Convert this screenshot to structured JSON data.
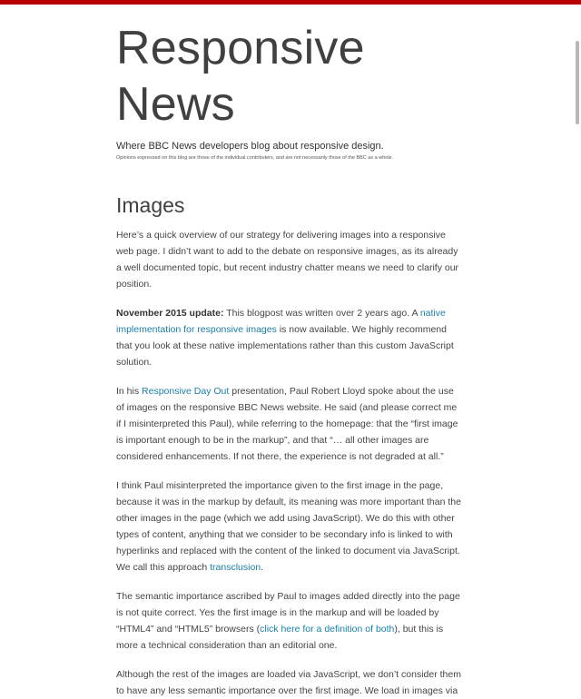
{
  "colors": {
    "top_bar": "#b80000",
    "link": "#1a7fa8"
  },
  "header": {
    "site_title": "Responsive News",
    "tagline": "Where BBC News developers blog about responsive design.",
    "disclaimer": "Opinions expressed on this blog are those of the individual contributers, and are not necessarily those of the BBC as a whole."
  },
  "post": {
    "title": "Images",
    "paragraphs": [
      [
        {
          "text": "Here’s a quick overview of our strategy for delivering images into a responsive web page. I didn’t want to add to the debate on responsive images, as its already a well documented topic, but recent industry chatter means we need to clarify our position."
        }
      ],
      [
        {
          "text": "November 2015 update:",
          "bold": true
        },
        {
          "text": " This blogpost was written over 2 years ago. A "
        },
        {
          "text": "native implementation for responsive images",
          "link": true
        },
        {
          "text": " is now available. We highly recommend that you look at these native implementations rather than this custom JavaScript solution."
        }
      ],
      [
        {
          "text": "In his "
        },
        {
          "text": "Responsive Day Out",
          "link": true
        },
        {
          "text": " presentation, Paul Robert Lloyd spoke about the use of images on the responsive BBC News website. He said (and please correct me if I misinterpreted this Paul), while referring to the homepage: that the “first image is important enough to be in the markup”, and that “… all other images are considered enhancements. If not there, the experience is not degraded at all.”"
        }
      ],
      [
        {
          "text": "I think Paul misinterpreted the importance given to the first image in the page, because it was in the markup by default, its meaning was more important than the other images in the page (which we add using JavaScript). We do this with other types of content, anything that we consider to be secondary info is linked to with hyperlinks and replaced with the content of the linked to document via JavaScript. We call this approach "
        },
        {
          "text": "transclusion",
          "link": true
        },
        {
          "text": "."
        }
      ],
      [
        {
          "text": "The semantic importance ascribed by Paul to images added directly into the page is not quite correct. Yes the first image is in the markup and will be loaded by “HTML4” and “HTML5” browsers ("
        },
        {
          "text": "click here for a definition of both",
          "link": true
        },
        {
          "text": "), but this is more a technical consideration than an editorial one."
        }
      ],
      [
        {
          "text": "Although the rest of the images are loaded via JavaScript, we don’t consider them to have any less semantic importance over the first image. We load in images via"
        }
      ]
    ]
  }
}
